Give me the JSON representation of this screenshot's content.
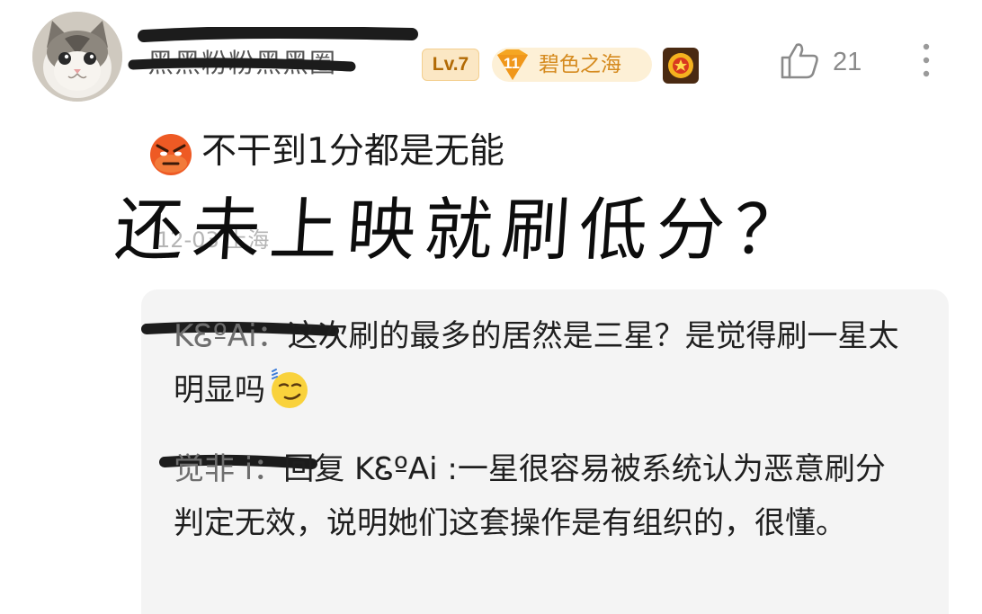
{
  "comment": {
    "author": {
      "name": "黑黑粉粉黑黑圈",
      "level": "Lv.7",
      "fan_level": "11",
      "fan_group": "碧色之海"
    },
    "likes": "21",
    "text": "不干到1分都是无能",
    "meta": "12-03 上海",
    "annotation": "还未上映就刷低分？"
  },
  "replies": [
    {
      "author": "KᏋºAi：",
      "text": "这次刷的最多的居然是三星？是觉得刷一星太明显吗"
    },
    {
      "author": "觉非 i：",
      "text": "回复 KᏋºAi :一星很容易被系统认为恶意刷分判定无效，说明她们这套操作是有组织的，很懂。"
    }
  ],
  "colors": {
    "level_badge": "#fbe7c4",
    "fan_badge": "#fdf0d6",
    "fan_text": "#d58a1e",
    "reply_bg": "#f4f4f4",
    "muted": "#8a8a8a"
  },
  "icons": {
    "avatar": "cat-photo",
    "like": "thumbs-up-icon",
    "more": "vertical-ellipsis-icon",
    "medal": "medal-icon",
    "emoji_1": "angry-face-emoji",
    "emoji_2": "smirk-face-emoji"
  }
}
